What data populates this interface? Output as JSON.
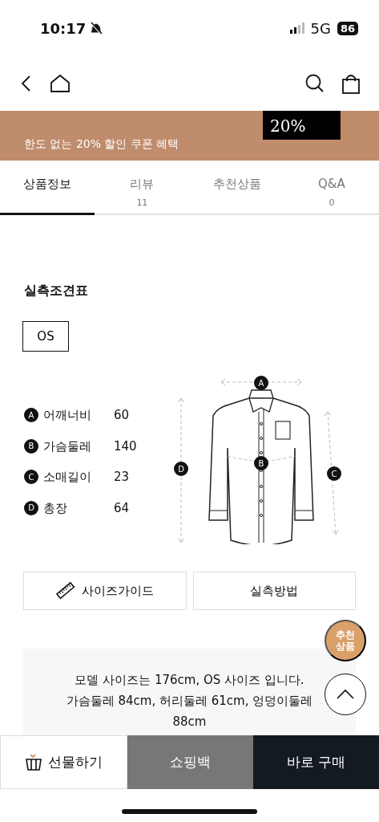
{
  "status_bar": {
    "time": "10:17",
    "network": "5G",
    "battery": "86"
  },
  "banner": {
    "subtitle": "한도 없는 20% 할인 쿠폰 혜택",
    "coupon": "20%"
  },
  "tabs": [
    {
      "label": "상품정보",
      "selected": true
    },
    {
      "label": "리뷰",
      "count": "11",
      "selected": false
    },
    {
      "label": "추천상품",
      "selected": false
    },
    {
      "label": "Q&A",
      "count": "0",
      "selected": false
    }
  ],
  "size_chart": {
    "title": "실측조견표",
    "sizes": [
      {
        "label": "OS",
        "selected": true
      }
    ],
    "measurements": [
      {
        "marker": "A",
        "label": "어깨너비",
        "value": "60"
      },
      {
        "marker": "B",
        "label": "가슴둘레",
        "value": "140"
      },
      {
        "marker": "C",
        "label": "소매길이",
        "value": "23"
      },
      {
        "marker": "D",
        "label": "총장",
        "value": "64"
      }
    ],
    "diagram_markers": [
      "A",
      "B",
      "C",
      "D"
    ]
  },
  "buttons": [
    {
      "label": "사이즈가이드",
      "kind": "guide"
    },
    {
      "label": "실측방법",
      "kind": "method"
    }
  ],
  "model_info": "모델 사이즈는 176cm, OS 사이즈 입니다.\n가슴둘레 84cm, 허리둘레 61cm, 엉덩이둘레 88cm",
  "floating": {
    "recommend": "추천\n상품"
  },
  "bottom_bar": [
    {
      "label": "선물하기",
      "kind": "gift"
    },
    {
      "label": "쇼핑백",
      "kind": "cart"
    },
    {
      "label": "바로 구매",
      "kind": "buy"
    }
  ]
}
